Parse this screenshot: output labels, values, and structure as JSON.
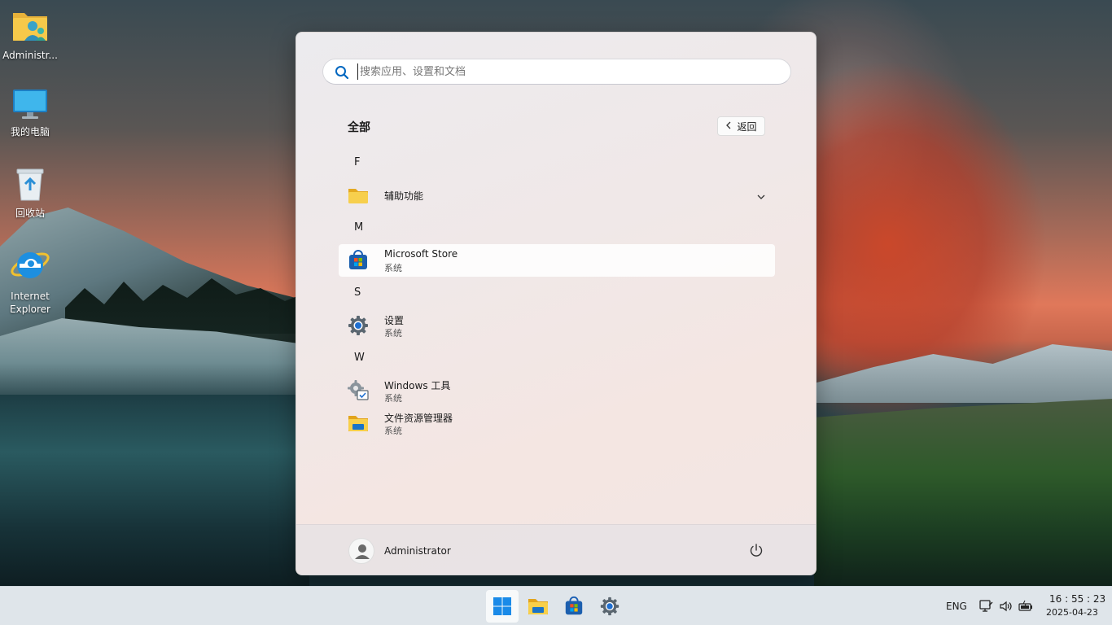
{
  "desktop": {
    "icons": [
      {
        "label": "Administr...",
        "icon": "user-folder-icon"
      },
      {
        "label": "我的电脑",
        "icon": "computer-icon"
      },
      {
        "label": "回收站",
        "icon": "recycle-bin-icon"
      },
      {
        "label": "Internet Explorer",
        "label_line1": "Internet",
        "label_line2": "Explorer",
        "icon": "internet-explorer-icon"
      }
    ]
  },
  "start_menu": {
    "search": {
      "placeholder": "搜索应用、设置和文档",
      "value": ""
    },
    "section_title": "全部",
    "back_label": "返回",
    "groups": [
      {
        "letter": "F",
        "apps": [
          {
            "name": "辅助功能",
            "sub": "",
            "icon": "folder-icon",
            "expandable": true
          }
        ]
      },
      {
        "letter": "M",
        "apps": [
          {
            "name": "Microsoft Store",
            "sub": "系统",
            "icon": "store-icon"
          }
        ]
      },
      {
        "letter": "S",
        "apps": [
          {
            "name": "设置",
            "sub": "系统",
            "icon": "settings-gear-icon"
          }
        ]
      },
      {
        "letter": "W",
        "apps": [
          {
            "name": "Windows 工具",
            "sub": "系统",
            "icon": "windows-tools-icon"
          },
          {
            "name": "文件资源管理器",
            "sub": "系统",
            "icon": "file-explorer-icon"
          }
        ]
      }
    ],
    "user": {
      "name": "Administrator"
    }
  },
  "taskbar": {
    "apps": [
      "start-icon",
      "file-explorer-icon",
      "store-icon",
      "settings-gear-icon"
    ],
    "language": "ENG",
    "time": "16 : 55 : 23",
    "date": "2025-04-23"
  },
  "colors": {
    "accent": "#0067c0",
    "taskbar_bg": "#dfe5ea",
    "folder_yellow": "#f2c94c"
  }
}
